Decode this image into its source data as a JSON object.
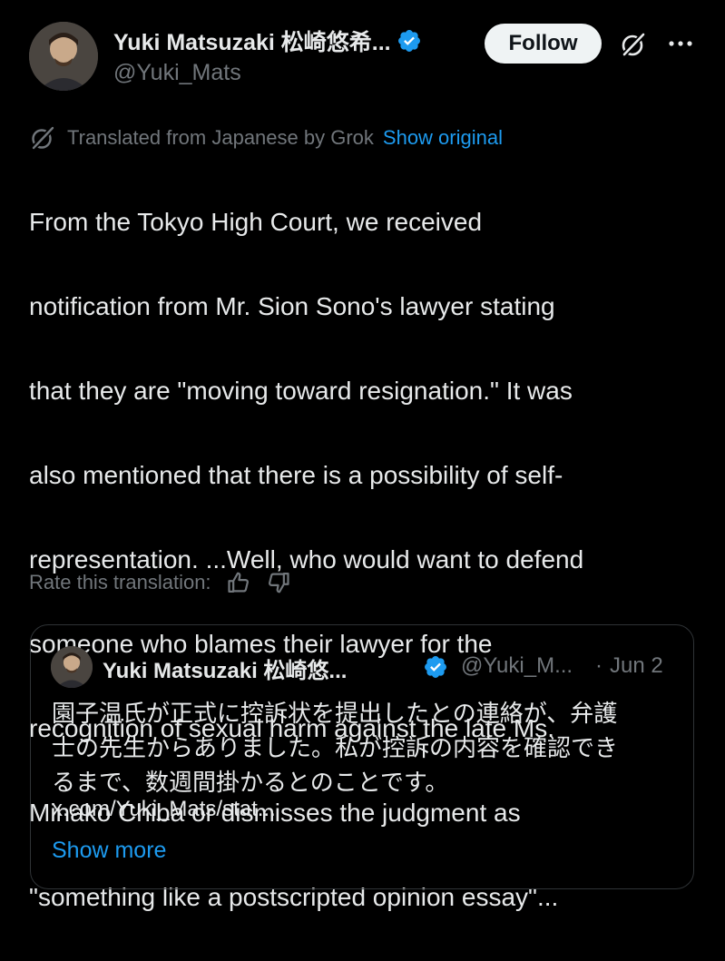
{
  "post": {
    "author": {
      "display_name": "Yuki Matsuzaki 松崎悠希...",
      "handle": "@Yuki_Mats",
      "verified": true
    },
    "follow_label": "Follow",
    "translation_notice": "Translated from Japanese by Grok",
    "show_original_label": "Show original",
    "body_lines": [
      "From the Tokyo High Court, we received",
      "notification from Mr. Sion Sono's lawyer stating",
      "that they are \"moving toward resignation.\" It was",
      "also mentioned that there is a possibility of self-",
      "representation. ...Well, who would want to defend",
      "someone who blames their lawyer for the",
      "recognition of sexual harm against the late Ms.",
      "Minako Chiba or dismisses the judgment as",
      "\"something like a postscripted opinion essay\"..."
    ],
    "rate_translation_label": "Rate this translation:"
  },
  "quote": {
    "display_name": "Yuki Matsuzaki 松崎悠...",
    "handle": "@Yuki_M...",
    "separator": "·",
    "date": "Jun 2",
    "body_lines": [
      "園子温氏が正式に控訴状を提出したとの連絡が、弁護",
      "士の先生からありました。私が控訴の内容を確認でき",
      "るまで、数週間掛かるとのことです。"
    ],
    "link_text": "x.com/Yuki_Mats/stat...",
    "show_more_label": "Show more"
  },
  "colors": {
    "background": "#000000",
    "text_primary": "#e7e9ea",
    "text_secondary": "#71767b",
    "accent_blue": "#1d9bf0",
    "border": "#2f3336",
    "follow_bg": "#eff3f4"
  },
  "icons": {
    "verified": "verified-badge-icon",
    "grok": "grok-icon",
    "more": "more-options-icon",
    "thumbs_up": "thumbs-up-icon",
    "thumbs_down": "thumbs-down-icon"
  }
}
